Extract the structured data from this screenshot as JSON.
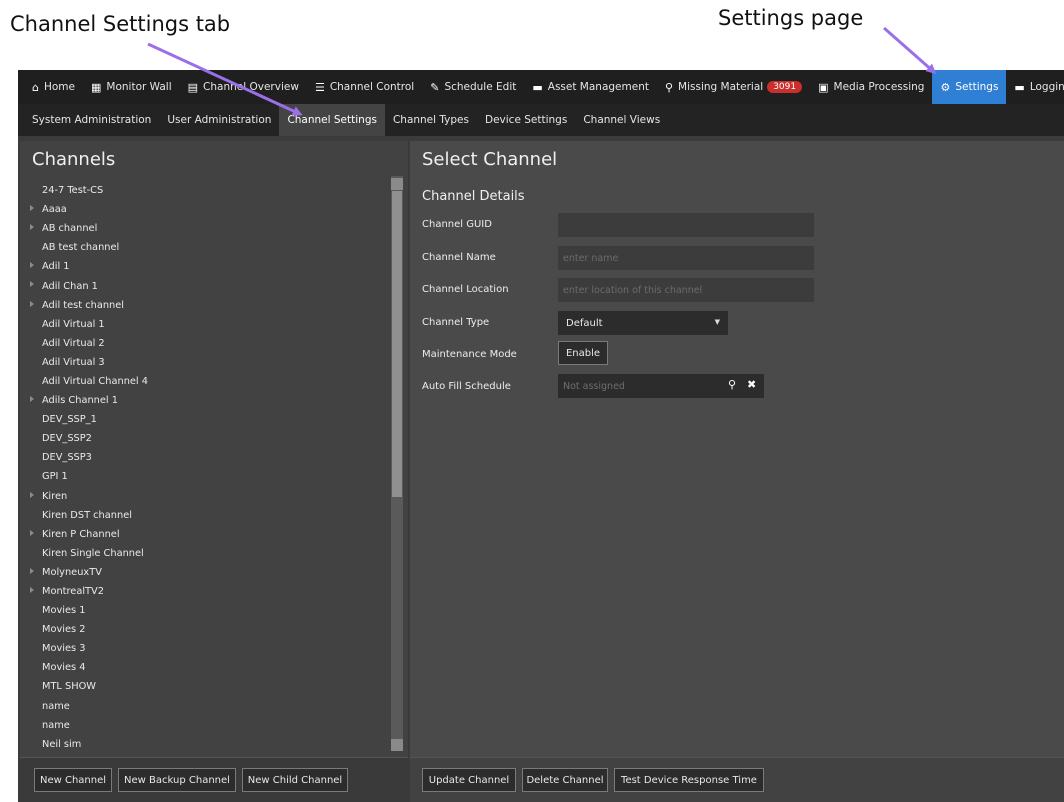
{
  "annotations": {
    "left": "Channel Settings tab",
    "right": "Settings page"
  },
  "topnav": [
    {
      "icon": "home-icon",
      "glyph": "⌂",
      "label": "Home"
    },
    {
      "icon": "grid-icon",
      "glyph": "▦",
      "label": "Monitor Wall"
    },
    {
      "icon": "overview-icon",
      "glyph": "▤",
      "label": "Channel Overview"
    },
    {
      "icon": "control-icon",
      "glyph": "☰",
      "label": "Channel Control"
    },
    {
      "icon": "edit-icon",
      "glyph": "✎",
      "label": "Schedule Edit"
    },
    {
      "icon": "folder-icon",
      "glyph": "▬",
      "label": "Asset Management"
    },
    {
      "icon": "search-icon",
      "glyph": "⚲",
      "label": "Missing Material",
      "badge": "3091"
    },
    {
      "icon": "media-icon",
      "glyph": "▣",
      "label": "Media Processing"
    },
    {
      "icon": "gear-icon",
      "glyph": "⚙",
      "label": "Settings",
      "active": true
    },
    {
      "icon": "logging-icon",
      "glyph": "▬",
      "label": "Logging"
    }
  ],
  "subnav": [
    {
      "label": "System Administration"
    },
    {
      "label": "User Administration"
    },
    {
      "label": "Channel Settings",
      "active": true
    },
    {
      "label": "Channel Types"
    },
    {
      "label": "Device Settings"
    },
    {
      "label": "Channel Views"
    }
  ],
  "left": {
    "title": "Channels",
    "channels": [
      {
        "label": "24-7 Test-CS",
        "expandable": false
      },
      {
        "label": "Aaaa",
        "expandable": true
      },
      {
        "label": "AB channel",
        "expandable": true
      },
      {
        "label": "AB test channel",
        "expandable": false
      },
      {
        "label": "Adil 1",
        "expandable": true
      },
      {
        "label": "Adil Chan 1",
        "expandable": true
      },
      {
        "label": "Adil test channel",
        "expandable": true
      },
      {
        "label": "Adil Virtual 1",
        "expandable": false
      },
      {
        "label": "Adil Virtual 2",
        "expandable": false
      },
      {
        "label": "Adil Virtual 3",
        "expandable": false
      },
      {
        "label": "Adil Virtual Channel 4",
        "expandable": false
      },
      {
        "label": "Adils Channel 1",
        "expandable": true
      },
      {
        "label": "DEV_SSP_1",
        "expandable": false
      },
      {
        "label": "DEV_SSP2",
        "expandable": false
      },
      {
        "label": "DEV_SSP3",
        "expandable": false
      },
      {
        "label": "GPI 1",
        "expandable": false
      },
      {
        "label": "Kiren",
        "expandable": true
      },
      {
        "label": "Kiren DST channel",
        "expandable": false
      },
      {
        "label": "Kiren P Channel",
        "expandable": true
      },
      {
        "label": "Kiren Single Channel",
        "expandable": false
      },
      {
        "label": "MolyneuxTV",
        "expandable": true
      },
      {
        "label": "MontrealTV2",
        "expandable": true
      },
      {
        "label": "Movies 1",
        "expandable": false
      },
      {
        "label": "Movies 2",
        "expandable": false
      },
      {
        "label": "Movies 3",
        "expandable": false
      },
      {
        "label": "Movies 4",
        "expandable": false
      },
      {
        "label": "MTL SHOW",
        "expandable": false
      },
      {
        "label": "name",
        "expandable": false
      },
      {
        "label": "name",
        "expandable": false
      },
      {
        "label": "Neil sim",
        "expandable": false
      }
    ],
    "buttons": {
      "new_channel": "New Channel",
      "new_backup": "New Backup Channel",
      "new_child": "New Child Channel"
    }
  },
  "right": {
    "title": "Select Channel",
    "section": "Channel Details",
    "fields": {
      "guid_label": "Channel GUID",
      "guid_value": "",
      "name_label": "Channel Name",
      "name_placeholder": "enter name",
      "location_label": "Channel Location",
      "location_placeholder": "enter location of this channel",
      "type_label": "Channel Type",
      "type_value": "Default",
      "maintenance_label": "Maintenance Mode",
      "maintenance_button": "Enable",
      "autofill_label": "Auto Fill Schedule",
      "autofill_value": "Not assigned"
    },
    "buttons": {
      "update": "Update Channel",
      "delete": "Delete Channel",
      "test": "Test Device Response Time"
    }
  }
}
